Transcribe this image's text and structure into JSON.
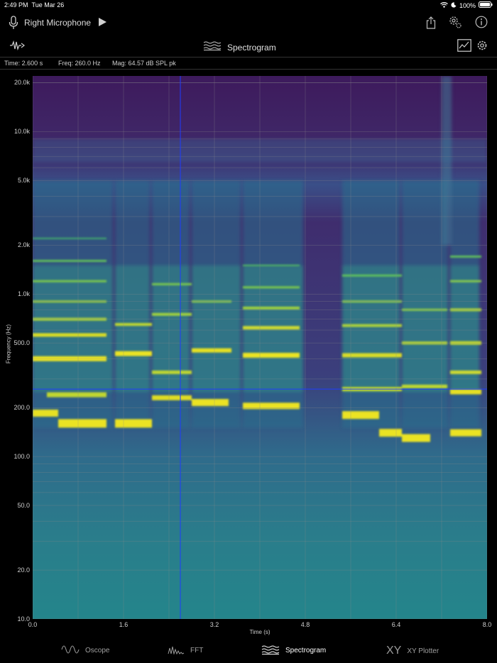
{
  "status_bar": {
    "time": "2:49 PM",
    "date": "Tue Mar 26",
    "battery": "100%"
  },
  "toolbar": {
    "input_label": "Right Microphone"
  },
  "view": {
    "title": "Spectrogram"
  },
  "readout": {
    "time": "Time: 2.600 s",
    "freq": "Freq: 260.0 Hz",
    "mag": "Mag: 64.57 dB SPL pk"
  },
  "axes": {
    "ylabel": "Frequency (Hz)",
    "xlabel": "Time (s)",
    "yticks": [
      "20.0k",
      "10.0k",
      "5.0k",
      "2.0k",
      "1.0k",
      "500.0",
      "200.0",
      "100.0",
      "50.0",
      "20.0",
      "10.0"
    ],
    "xticks": [
      "0.0",
      "1.6",
      "3.2",
      "4.8",
      "6.4",
      "8.0"
    ]
  },
  "tabs": [
    {
      "label": "Oscope"
    },
    {
      "label": "FFT"
    },
    {
      "label": "Spectrogram"
    },
    {
      "label": "XY Plotter"
    }
  ],
  "chart_data": {
    "type": "heatmap",
    "xlabel": "Time (s)",
    "ylabel": "Frequency (Hz)",
    "xlim": [
      0,
      8
    ],
    "ylim": [
      10,
      22000
    ],
    "yscale": "log",
    "grid": true,
    "cursor": {
      "time_s": 2.6,
      "freq_hz": 260
    },
    "colormap": "viridis"
  }
}
